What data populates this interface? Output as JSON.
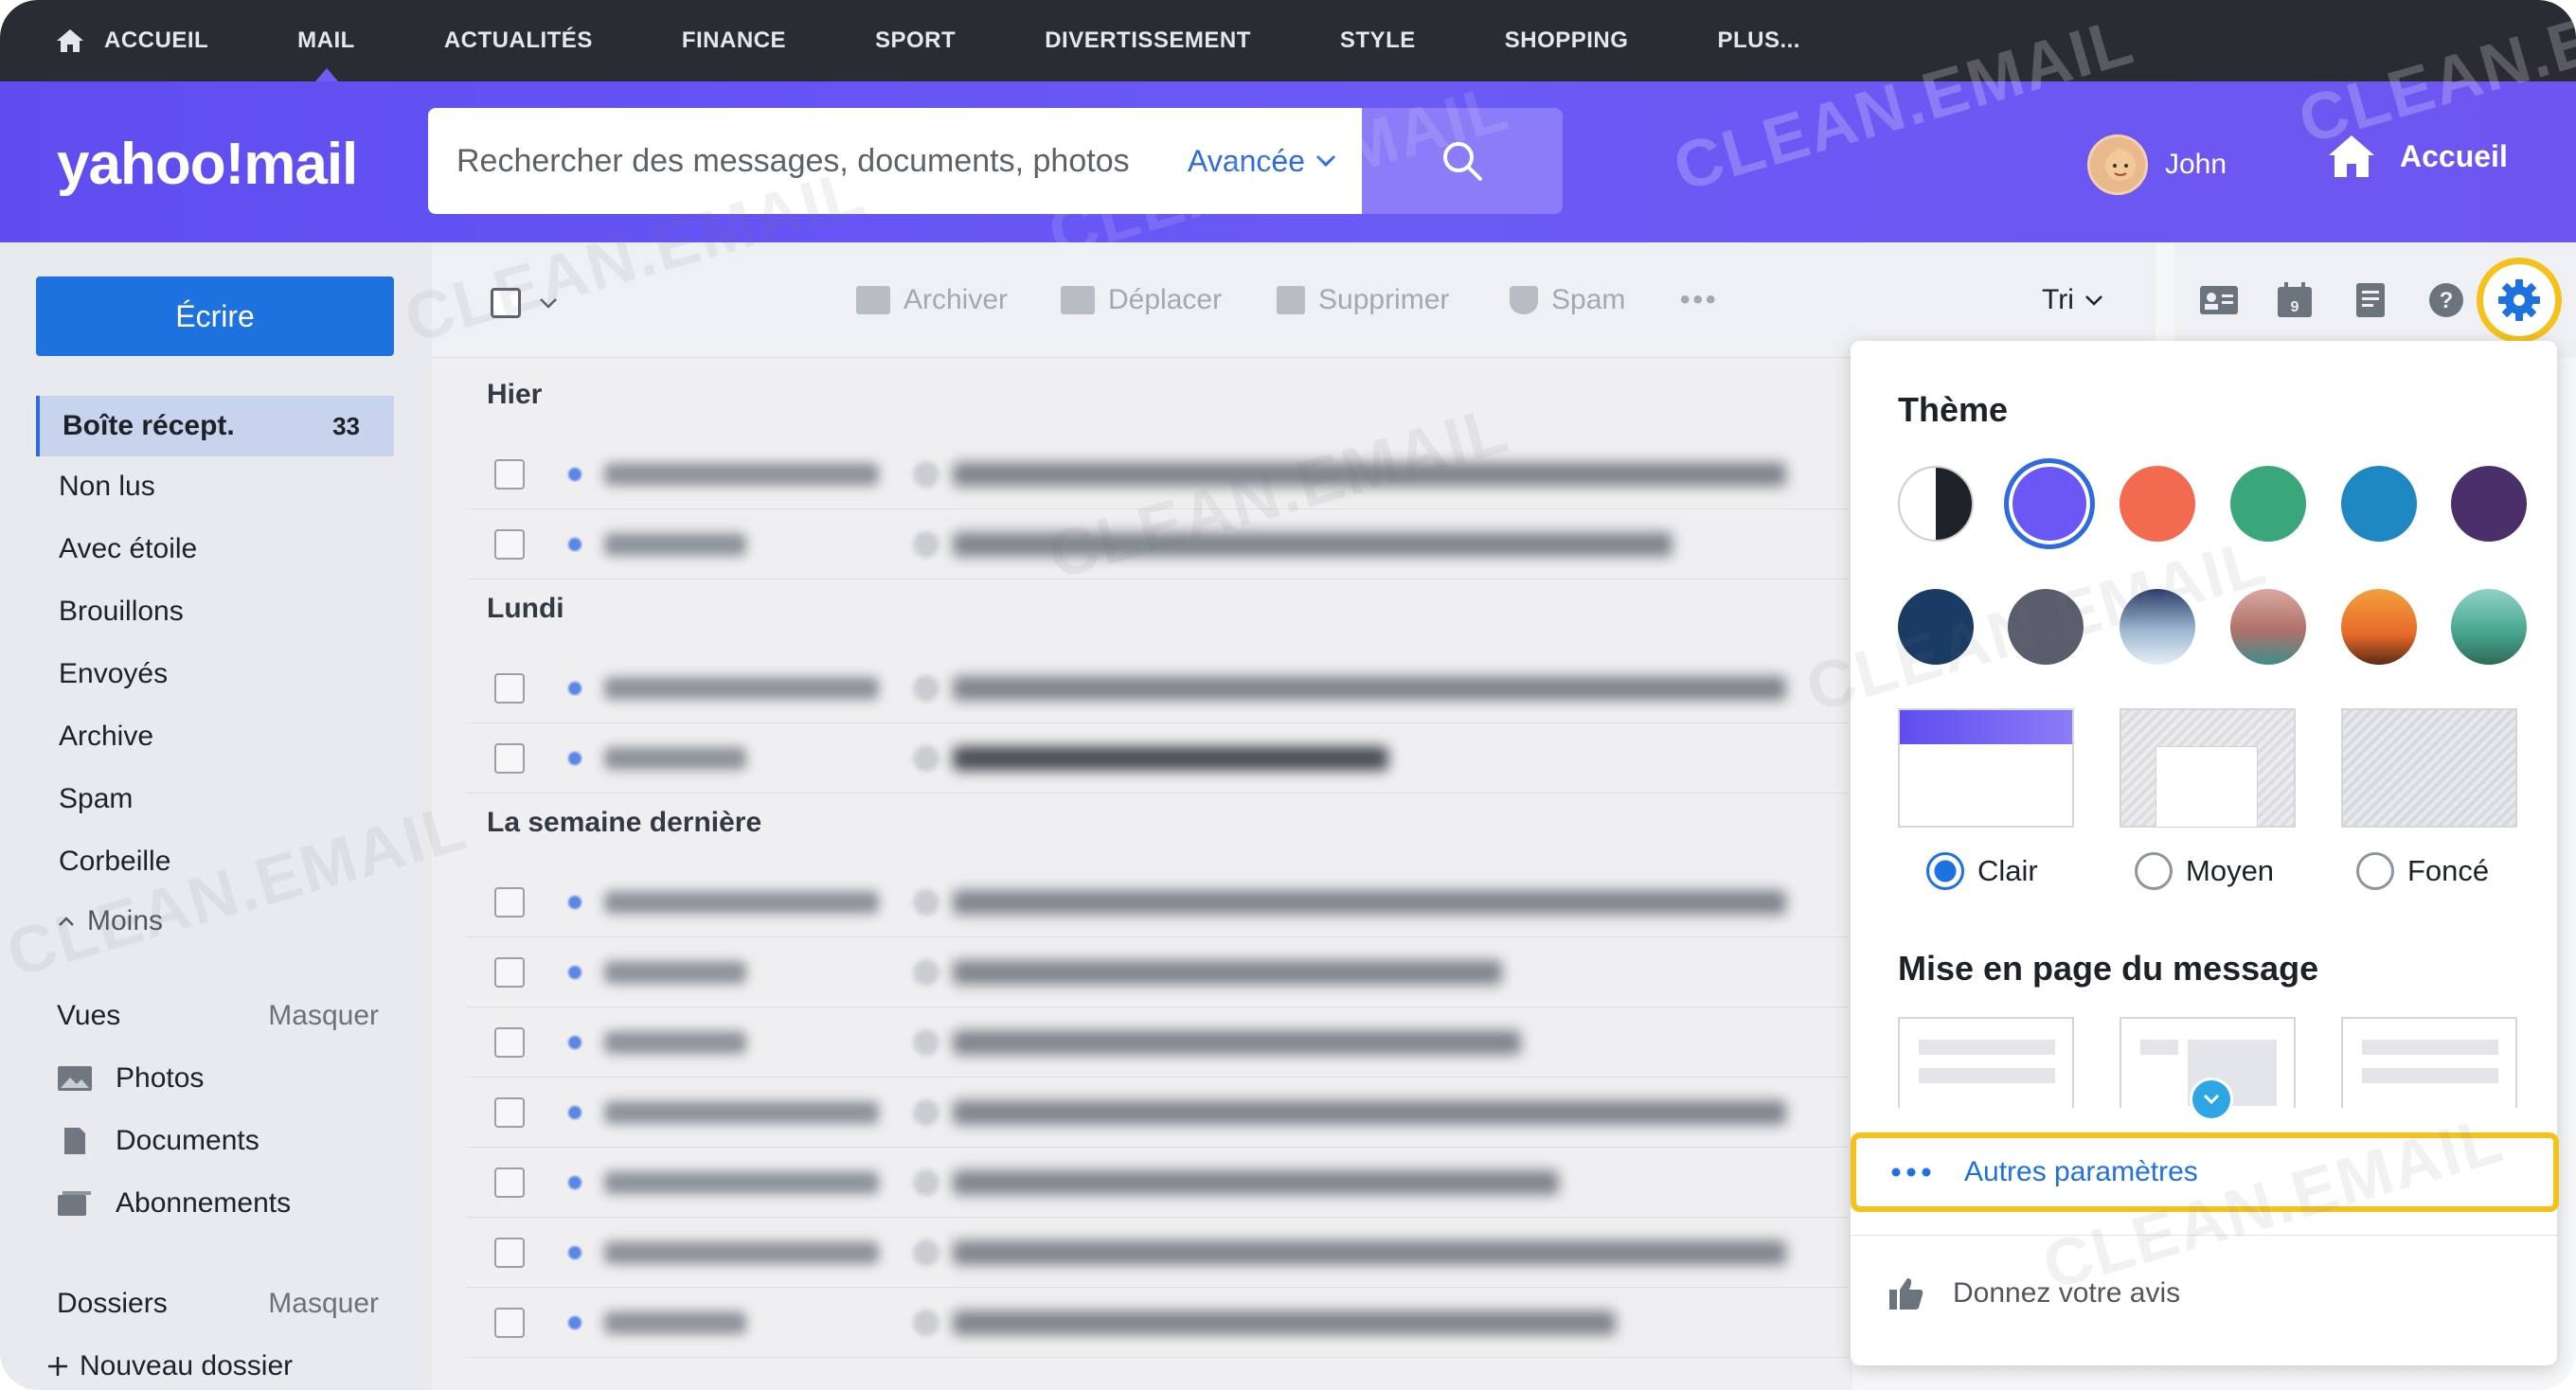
{
  "topnav": {
    "items": [
      "ACCUEIL",
      "MAIL",
      "ACTUALITÉS",
      "FINANCE",
      "SPORT",
      "DIVERTISSEMENT",
      "STYLE",
      "SHOPPING",
      "PLUS..."
    ]
  },
  "header": {
    "logo": "yahoo!mail",
    "search_placeholder": "Rechercher des messages, documents, photos",
    "advanced": "Avancée",
    "user_name": "John",
    "home": "Accueil"
  },
  "sidebar": {
    "compose": "Écrire",
    "folders": [
      {
        "label": "Boîte récept.",
        "count": "33"
      },
      {
        "label": "Non lus"
      },
      {
        "label": "Avec étoile"
      },
      {
        "label": "Brouillons"
      },
      {
        "label": "Envoyés"
      },
      {
        "label": "Archive"
      },
      {
        "label": "Spam"
      },
      {
        "label": "Corbeille"
      }
    ],
    "less": "Moins",
    "views_title": "Vues",
    "views_hide": "Masquer",
    "views": [
      "Photos",
      "Documents",
      "Abonnements"
    ],
    "folders_title": "Dossiers",
    "folders_hide": "Masquer",
    "new_folder": "Nouveau dossier"
  },
  "toolbar": {
    "archive": "Archiver",
    "move": "Déplacer",
    "delete": "Supprimer",
    "spam": "Spam",
    "more": "•••",
    "sort": "Tri"
  },
  "list": {
    "sections": [
      "Hier",
      "Lundi",
      "La semaine dernière"
    ]
  },
  "settings": {
    "theme_title": "Thème",
    "theme_colors": [
      "#6b57f5",
      "#f26a4f",
      "#3aa77a",
      "#1f87c2",
      "#4a2f6b",
      "#1a3b63",
      "#5a5d6b"
    ],
    "modes": [
      "Clair",
      "Moyen",
      "Foncé"
    ],
    "layout_title": "Mise en page du message",
    "more_settings": "Autres paramètres",
    "feedback": "Donnez votre avis"
  },
  "watermark": "CLEAN.EMAIL"
}
